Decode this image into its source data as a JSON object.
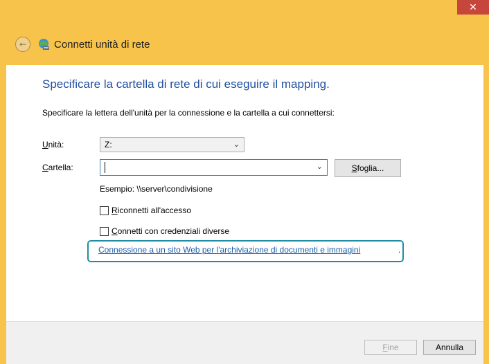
{
  "window": {
    "title": "Connetti unità di rete",
    "close_glyph": "✕"
  },
  "header": {
    "back_glyph": "←",
    "icon": "network-drive-icon"
  },
  "main": {
    "heading": "Specificare la cartella di rete di cui eseguire il mapping.",
    "instruction": "Specificare la lettera dell'unità per la connessione e la cartella a cui connettersi:",
    "drive": {
      "label_accel": "U",
      "label_rest": "nità:",
      "value": "Z:"
    },
    "folder": {
      "label_accel": "C",
      "label_rest": "artella:",
      "value": ""
    },
    "browse": {
      "accel": "S",
      "rest": "foglia..."
    },
    "example": "Esempio: \\\\server\\condivisione",
    "reconnect": {
      "accel": "R",
      "rest": "iconnetti all'accesso",
      "checked": false
    },
    "credentials": {
      "accel": "C",
      "rest": "onnetti con credenziali diverse",
      "checked": false
    },
    "link_text": "Connessione a un sito Web per l'archiviazione di documenti e immagini",
    "link_suffix": "."
  },
  "footer": {
    "fine": {
      "accel": "F",
      "rest": "ine",
      "enabled": false
    },
    "cancel_label": "Annulla"
  },
  "colors": {
    "frame": "#f8c34a",
    "close": "#c7463c",
    "heading": "#1f4fa0",
    "link": "#1a5ca8",
    "highlight": "#1f8ea5"
  }
}
